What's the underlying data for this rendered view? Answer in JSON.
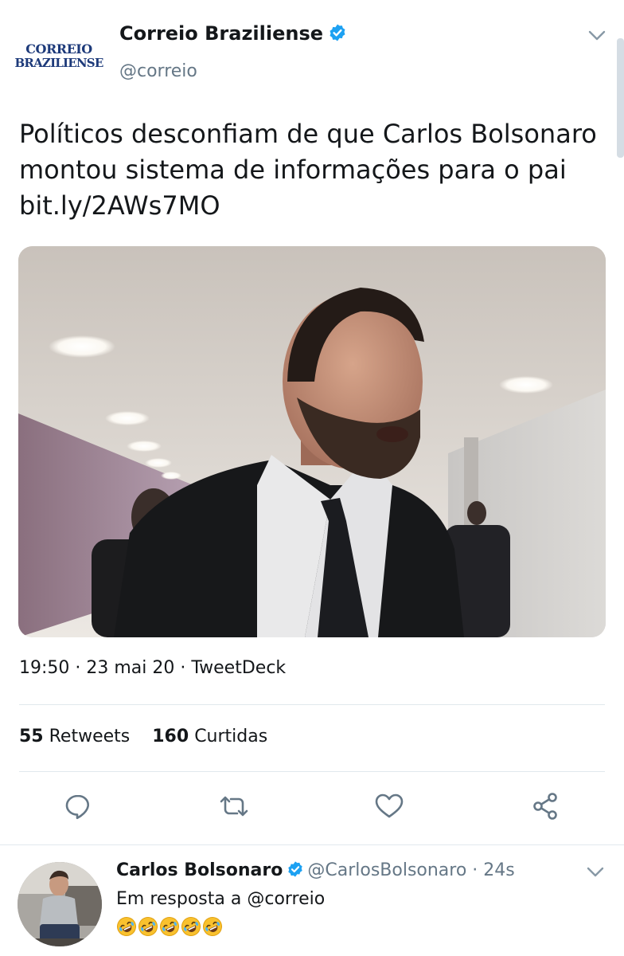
{
  "tweet": {
    "author": {
      "name": "Correio Braziliense",
      "handle": "@correio",
      "verified": true,
      "logo_line1": "CORREIO",
      "logo_line2": "BRAZILIENSE"
    },
    "text_line1": "Políticos desconfiam de que Carlos Bolsonaro",
    "text_line2": "montou sistema de informações para o pai",
    "link": "bit.ly/2AWs7MO",
    "meta": "19:50 · 23 mai 20 · TweetDeck",
    "retweets_count": "55",
    "retweets_label": "Retweets",
    "likes_count": "160",
    "likes_label": "Curtidas",
    "actions": [
      "reply-icon",
      "retweet-icon",
      "like-icon",
      "share-icon"
    ]
  },
  "reply": {
    "name": "Carlos Bolsonaro",
    "handle": "@CarlosBolsonaro · 24s",
    "verified": true,
    "in_reply_to": "Em resposta a @correio",
    "emoji_content": "🤣🤣🤣🤣🤣"
  },
  "colors": {
    "verified": "#1da1f2",
    "secondary_text": "#657786",
    "divider": "#e1e8ed",
    "icon": "#657786"
  }
}
